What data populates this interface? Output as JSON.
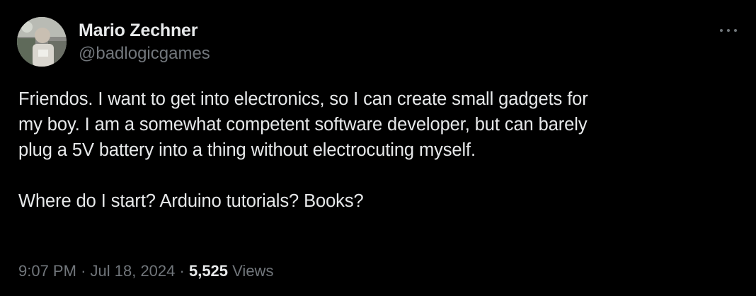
{
  "author": {
    "display_name": "Mario Zechner",
    "handle": "@badlogicgames",
    "avatar": "profile-photo"
  },
  "more_icon": "more-horizontal-icon",
  "tweet": {
    "paragraphs": [
      "Friendos. I want to get into electronics, so I can create small gadgets for\nmy boy. I am a somewhat competent software developer, but can barely\nplug a 5V battery into a thing without electrocuting myself.",
      "Where do I start? Arduino tutorials? Books?"
    ]
  },
  "meta": {
    "time": "9:07 PM",
    "separator": "·",
    "date": "Jul 18, 2024",
    "views_count": "5,525",
    "views_label": "Views"
  },
  "colors": {
    "background": "#000000",
    "primary_text": "#e7e9ea",
    "secondary_text": "#71767b"
  }
}
